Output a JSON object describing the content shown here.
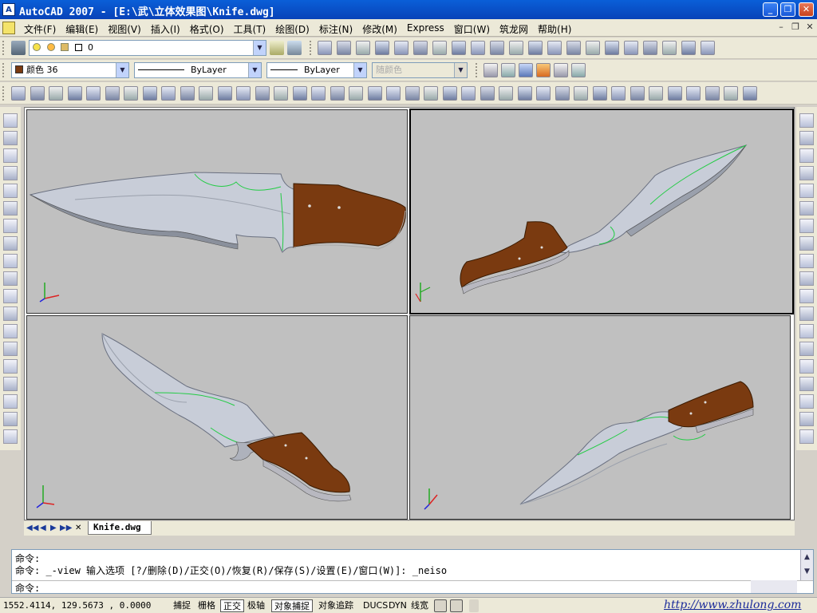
{
  "titlebar": {
    "app_icon_text": "A",
    "title": "AutoCAD 2007 - [E:\\武\\立体效果图\\Knife.dwg]",
    "minimize": "_",
    "restore": "❐",
    "close": "✕"
  },
  "menu": {
    "items": [
      "文件(F)",
      "编辑(E)",
      "视图(V)",
      "插入(I)",
      "格式(O)",
      "工具(T)",
      "绘图(D)",
      "标注(N)",
      "修改(M)",
      "Express",
      "窗口(W)",
      "筑龙网",
      "帮助(H)"
    ],
    "doc_minimize": "–",
    "doc_restore": "❐",
    "doc_close": "✕"
  },
  "layers": {
    "current_layer": "0"
  },
  "properties": {
    "color": "颜色 36",
    "linetype": "ByLayer",
    "lineweight": "ByLayer",
    "plotstyle": "随颜色"
  },
  "colors": {
    "titlebar": "#0a4fd0",
    "viewport_bg": "#c0c0c0",
    "blade": "#c8cdd8",
    "handle": "#7a3a10",
    "edge_green": "#22cc44"
  },
  "tabs": {
    "model": "Knife.dwg"
  },
  "command": {
    "line1": "命令:",
    "line2": "命令: _-view 输入选项 [?/删除(D)/正交(O)/恢复(R)/保存(S)/设置(E)/窗口(W)]: _neiso",
    "prompt": "命令:"
  },
  "status": {
    "coords": "1552.4114, 129.5673 , 0.0000",
    "buttons": [
      "捕捉",
      "栅格",
      "正交",
      "极轴",
      "对象捕捉",
      "对象追踪",
      "DUCS",
      "DYN",
      "线宽"
    ],
    "link": "http://www.zhulong.com"
  }
}
